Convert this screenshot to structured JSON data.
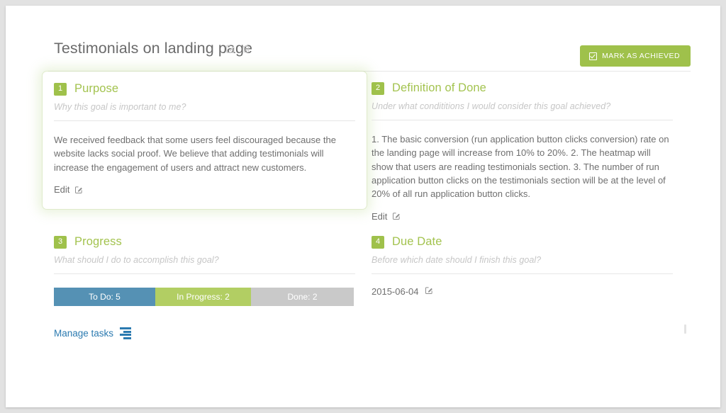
{
  "header": {
    "title": "Testimonials on landing page",
    "edit_icon": "edit-pencil-square-icon",
    "delete_icon": "trash-icon",
    "mark_achieved_label": "MARK AS ACHIEVED"
  },
  "panels": [
    {
      "number": "1",
      "title": "Purpose",
      "subtitle": "Why this goal is important to me?",
      "body": "We received feedback that some users feel discouraged because the website lacks social proof. We believe that adding testimonials will increase the engagement of users and attract new customers.",
      "edit_label": "Edit"
    },
    {
      "number": "2",
      "title": "Definition of Done",
      "subtitle": "Under what condititions I would consider this goal achieved?",
      "body": "1. The basic conversion (run application button clicks conversion) rate on the landing page will increase from 10% to 20%. 2. The heatmap will show that users are reading testimonials section. 3. The number of run application button clicks on the testimonials section will be at the level of 20% of all run application button clicks.",
      "edit_label": "Edit"
    },
    {
      "number": "3",
      "title": "Progress",
      "subtitle": "What should I do to accomplish this goal?",
      "manage_tasks_label": "Manage tasks"
    },
    {
      "number": "4",
      "title": "Due Date",
      "subtitle": "Before which date should I finish this goal?",
      "value": "2015-06-04"
    }
  ],
  "progress": {
    "segments": [
      {
        "label": "To Do: 5",
        "count": 5,
        "color": "#5591b4"
      },
      {
        "label": "In Progress: 2",
        "count": 2,
        "color": "#b2ce63"
      },
      {
        "label": "Done: 2",
        "count": 2,
        "color": "#c9c9c9"
      }
    ]
  },
  "colors": {
    "accent_green": "#9fc14b",
    "title_green": "#a3c34f",
    "link_blue": "#2b7ab0",
    "text_gray": "#6f6f6f"
  }
}
